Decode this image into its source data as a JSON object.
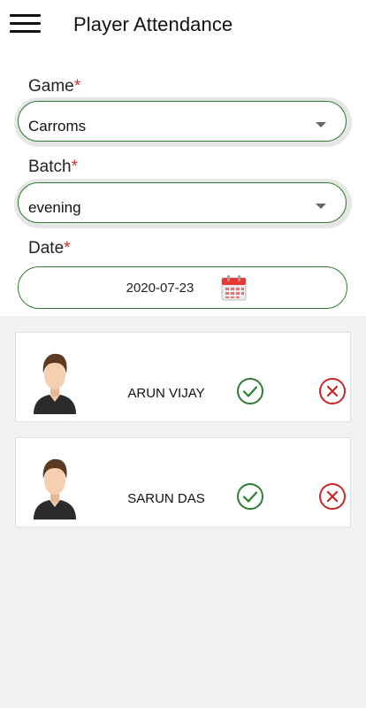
{
  "header": {
    "title": "Player Attendance",
    "menu_icon": "hamburger-menu-icon"
  },
  "form": {
    "game": {
      "label": "Game",
      "required_mark": "*",
      "value": "Carroms"
    },
    "batch": {
      "label": "Batch",
      "required_mark": "*",
      "value": "evening"
    },
    "date": {
      "label": "Date",
      "required_mark": "*",
      "value": "2020-07-23",
      "icon": "calendar-icon"
    }
  },
  "players": [
    {
      "name": "ARUN VIJAY"
    },
    {
      "name": "SARUN DAS"
    }
  ],
  "colors": {
    "accent_green": "#2e7d32",
    "required_red": "#d32f2f",
    "reject_red": "#c62828"
  }
}
